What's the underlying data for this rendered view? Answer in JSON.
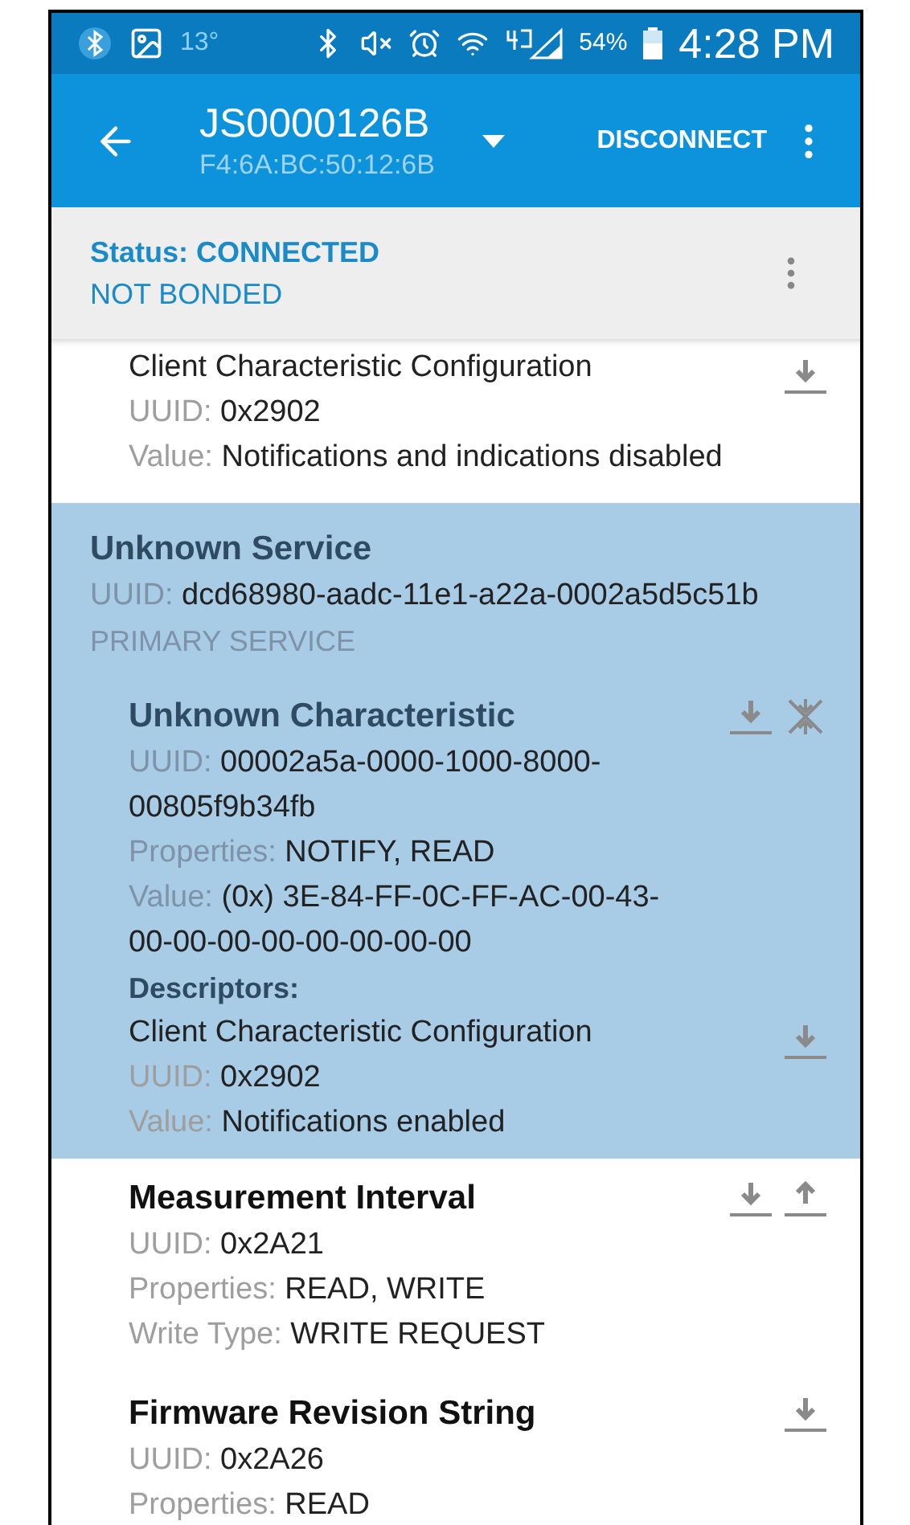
{
  "status_bar": {
    "temperature": "13°",
    "battery": "54%",
    "time": "4:28 PM"
  },
  "app_bar": {
    "device_name": "JS0000126B",
    "address": "F4:6A:BC:50:12:6B",
    "action": "DISCONNECT"
  },
  "connection": {
    "status": "Status: CONNECTED",
    "bond": "NOT BONDED"
  },
  "items": [
    {
      "kind": "descriptor",
      "selected": false,
      "name": "Client Characteristic Configuration",
      "fields": [
        {
          "label": "UUID:",
          "value": "0x2902"
        },
        {
          "label": "Value:",
          "value": "Notifications and indications disabled"
        }
      ],
      "actions": [
        {
          "kind": "read"
        }
      ]
    },
    {
      "kind": "service",
      "selected": true,
      "name": "Unknown Service",
      "fields": [
        {
          "label": "UUID:",
          "value": "dcd68980-aadc-11e1-a22a-0002a5d5c51b"
        }
      ],
      "type": "PRIMARY SERVICE",
      "characteristics": [
        {
          "name": "Unknown Characteristic",
          "fields": [
            {
              "label": "UUID:",
              "value": "00002a5a-0000-1000-8000-00805f9b34fb"
            },
            {
              "label": "Properties:",
              "value": "NOTIFY, READ"
            },
            {
              "label": "Value:",
              "value": "(0x) 3E-84-FF-0C-FF-AC-00-43-00-00-00-00-00-00-00-00"
            }
          ],
          "actions": [
            {
              "kind": "read"
            },
            {
              "kind": "notify"
            }
          ],
          "descriptors_label": "Descriptors:",
          "descriptors": [
            {
              "name": "Client Characteristic Configuration",
              "fields": [
                {
                  "label": "UUID:",
                  "value": "0x2902"
                },
                {
                  "label": "Value:",
                  "value": "Notifications enabled"
                }
              ],
              "actions": [
                {
                  "kind": "read"
                }
              ]
            }
          ]
        }
      ]
    },
    {
      "kind": "characteristic",
      "selected": false,
      "name": "Measurement Interval",
      "fields": [
        {
          "label": "UUID:",
          "value": "0x2A21"
        },
        {
          "label": "Properties:",
          "value": "READ, WRITE"
        },
        {
          "label": "Write Type:",
          "value": "WRITE REQUEST"
        }
      ],
      "actions": [
        {
          "kind": "read"
        },
        {
          "kind": "write"
        }
      ]
    },
    {
      "kind": "characteristic",
      "selected": false,
      "name": "Firmware Revision String",
      "fields": [
        {
          "label": "UUID:",
          "value": "0x2A26"
        },
        {
          "label": "Properties:",
          "value": "READ"
        }
      ],
      "actions": [
        {
          "kind": "read"
        }
      ]
    }
  ]
}
